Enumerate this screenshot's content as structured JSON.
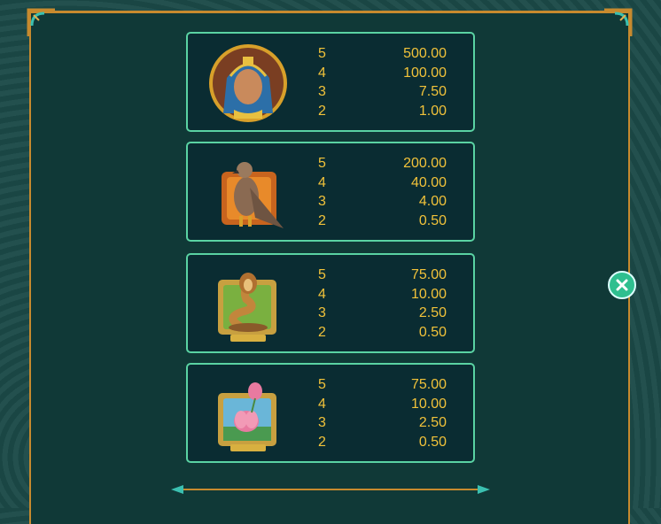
{
  "paytable": [
    {
      "symbol": "pharaoh-icon",
      "rows": [
        {
          "count": "5",
          "pay": "500.00"
        },
        {
          "count": "4",
          "pay": "100.00"
        },
        {
          "count": "3",
          "pay": "7.50"
        },
        {
          "count": "2",
          "pay": "1.00"
        }
      ]
    },
    {
      "symbol": "falcon-icon",
      "rows": [
        {
          "count": "5",
          "pay": "200.00"
        },
        {
          "count": "4",
          "pay": "40.00"
        },
        {
          "count": "3",
          "pay": "4.00"
        },
        {
          "count": "2",
          "pay": "0.50"
        }
      ]
    },
    {
      "symbol": "cobra-icon",
      "rows": [
        {
          "count": "5",
          "pay": "75.00"
        },
        {
          "count": "4",
          "pay": "10.00"
        },
        {
          "count": "3",
          "pay": "2.50"
        },
        {
          "count": "2",
          "pay": "0.50"
        }
      ]
    },
    {
      "symbol": "lotus-icon",
      "rows": [
        {
          "count": "5",
          "pay": "75.00"
        },
        {
          "count": "4",
          "pay": "10.00"
        },
        {
          "count": "3",
          "pay": "2.50"
        },
        {
          "count": "2",
          "pay": "0.50"
        }
      ]
    }
  ],
  "colors": {
    "accent": "#5ad3a3",
    "gold": "#f1c23a",
    "frame": "#c78a2e",
    "close": "#2fbf8f"
  },
  "close_icon": "close-icon"
}
